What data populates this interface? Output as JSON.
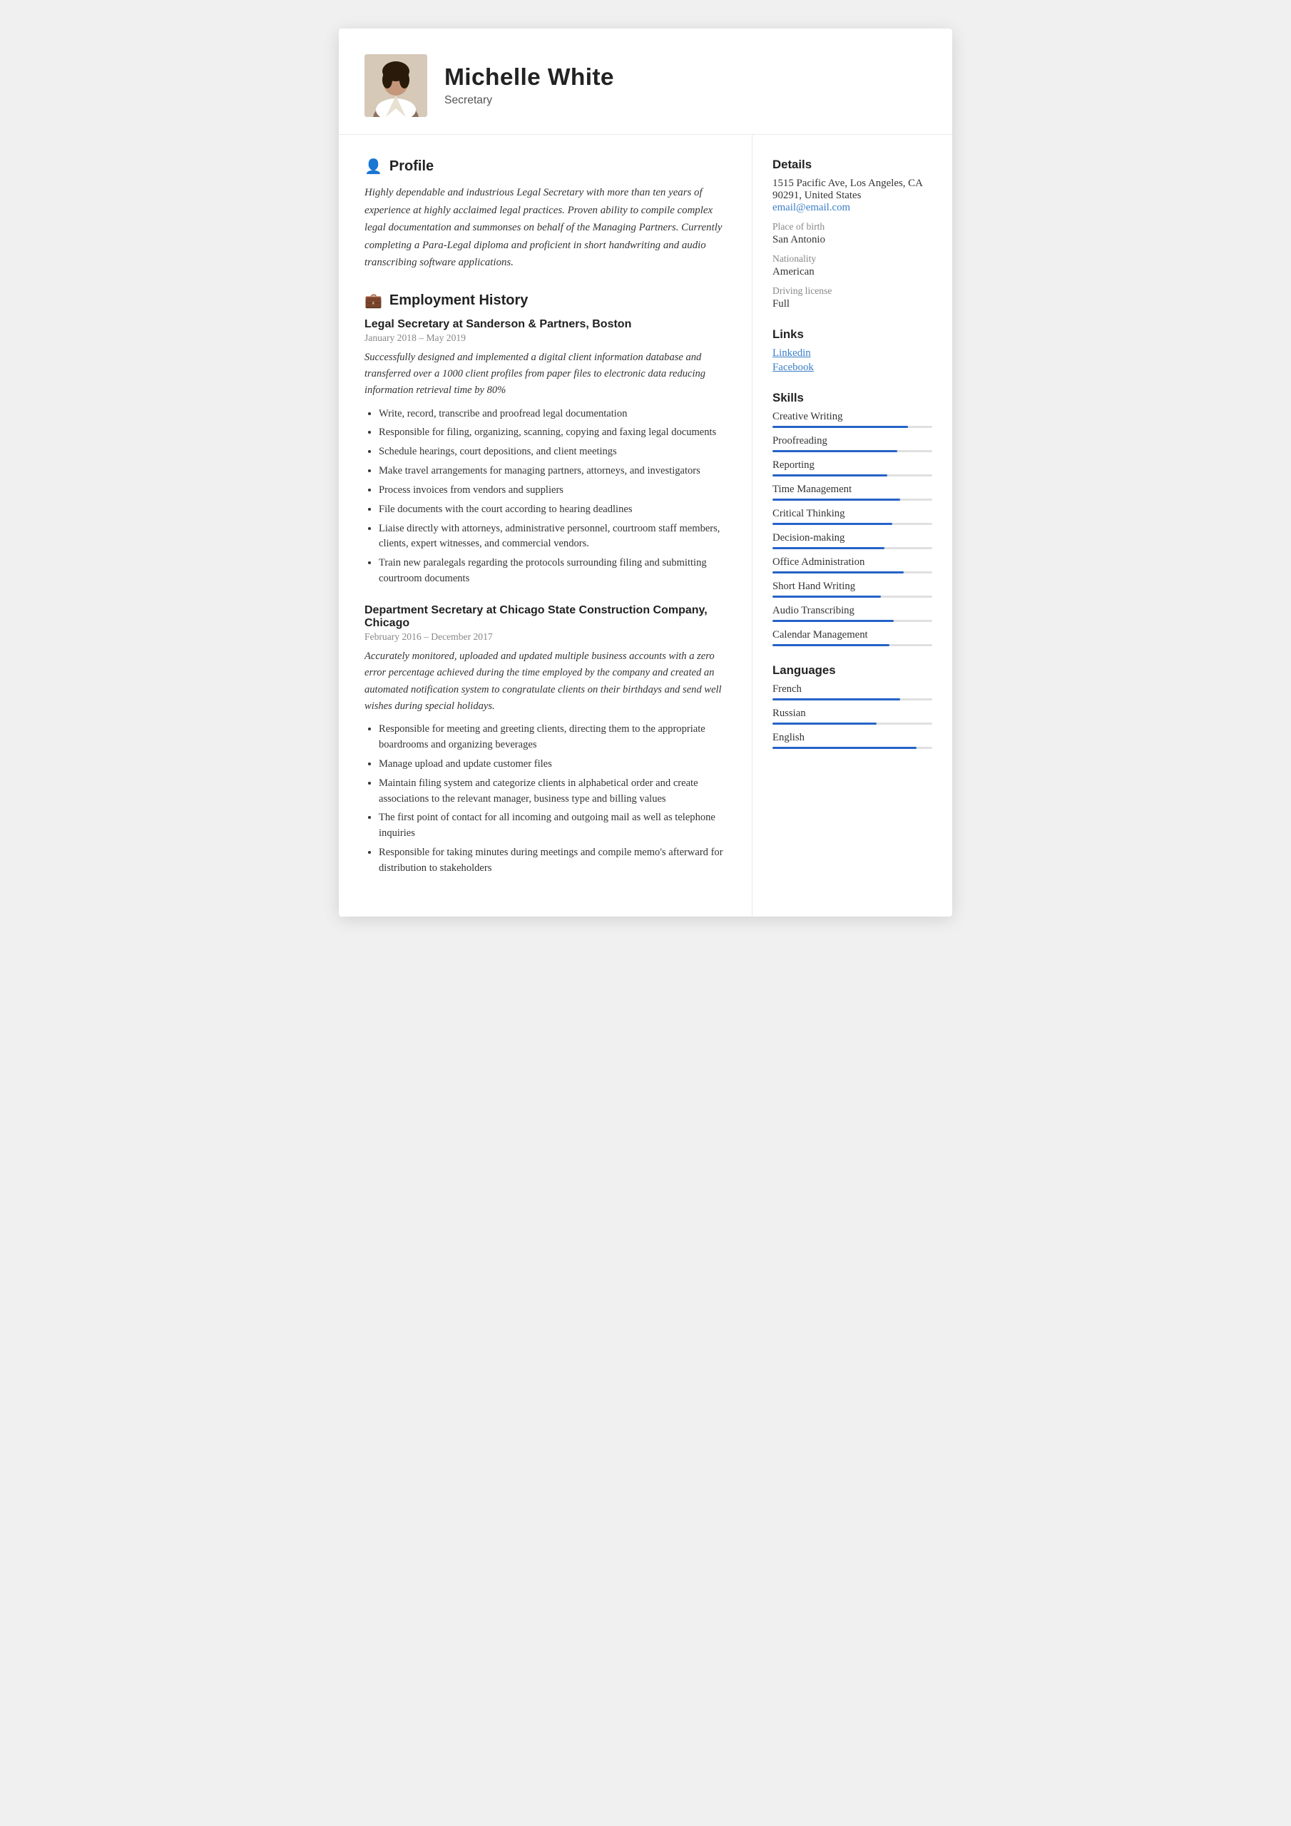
{
  "header": {
    "name": "Michelle White",
    "title": "Secretary",
    "avatar_alt": "Michelle White photo"
  },
  "profile": {
    "section_label": "Profile",
    "text": "Highly dependable and industrious Legal Secretary with more than ten years of experience at highly acclaimed legal practices. Proven ability to compile complex legal documentation and summonses on behalf of the Managing Partners. Currently completing a Para-Legal diploma and proficient in short handwriting and audio transcribing software applications."
  },
  "employment": {
    "section_label": "Employment History",
    "jobs": [
      {
        "title": "Legal Secretary at Sanderson & Partners, Boston",
        "dates": "January 2018 – May 2019",
        "summary": "Successfully designed and implemented a digital client information database and transferred over a 1000 client profiles from paper files to electronic data reducing information retrieval time by 80%",
        "bullets": [
          "Write, record, transcribe and proofread legal documentation",
          "Responsible for filing, organizing, scanning, copying and faxing legal documents",
          "Schedule hearings, court depositions, and client meetings",
          "Make travel arrangements for managing partners, attorneys, and investigators",
          "Process invoices from vendors and suppliers",
          "File documents with the court according to hearing deadlines",
          "Liaise directly with attorneys, administrative personnel, courtroom staff members, clients, expert witnesses, and commercial vendors.",
          "Train new paralegals regarding the protocols surrounding filing and submitting courtroom documents"
        ]
      },
      {
        "title": "Department Secretary at Chicago State Construction Company, Chicago",
        "dates": "February 2016 – December 2017",
        "summary": "Accurately monitored, uploaded and updated multiple business accounts with a zero error percentage achieved during the time employed by the company and created an automated notification system to congratulate clients on their birthdays and send well wishes during special holidays.",
        "bullets": [
          "Responsible for meeting and greeting clients, directing them to the appropriate boardrooms and organizing beverages",
          "Manage upload and update customer files",
          "Maintain filing system and categorize clients in alphabetical order and create associations to the relevant manager, business type and billing values",
          "The first point of contact for all incoming and outgoing mail as well as telephone inquiries",
          "Responsible for taking minutes during meetings and compile memo's afterward for distribution to stakeholders"
        ]
      }
    ]
  },
  "details": {
    "section_label": "Details",
    "address": "1515 Pacific Ave, Los Angeles, CA 90291, United States",
    "email": "email@email.com",
    "place_of_birth_label": "Place of birth",
    "place_of_birth": "San Antonio",
    "nationality_label": "Nationality",
    "nationality": "American",
    "driving_license_label": "Driving license",
    "driving_license": "Full"
  },
  "links": {
    "section_label": "Links",
    "items": [
      {
        "label": "Linkedin"
      },
      {
        "label": "Facebook"
      }
    ]
  },
  "skills": {
    "section_label": "Skills",
    "items": [
      {
        "name": "Creative Writing",
        "pct": 85
      },
      {
        "name": "Proofreading",
        "pct": 78
      },
      {
        "name": "Reporting",
        "pct": 72
      },
      {
        "name": "Time Management",
        "pct": 80
      },
      {
        "name": "Critical Thinking",
        "pct": 75
      },
      {
        "name": "Decision-making",
        "pct": 70
      },
      {
        "name": "Office Administration",
        "pct": 82
      },
      {
        "name": "Short Hand Writing",
        "pct": 68
      },
      {
        "name": "Audio Transcribing",
        "pct": 76
      },
      {
        "name": "Calendar Management",
        "pct": 73
      }
    ]
  },
  "languages": {
    "section_label": "Languages",
    "items": [
      {
        "name": "French",
        "pct": 80
      },
      {
        "name": "Russian",
        "pct": 65
      },
      {
        "name": "English",
        "pct": 90
      }
    ]
  }
}
